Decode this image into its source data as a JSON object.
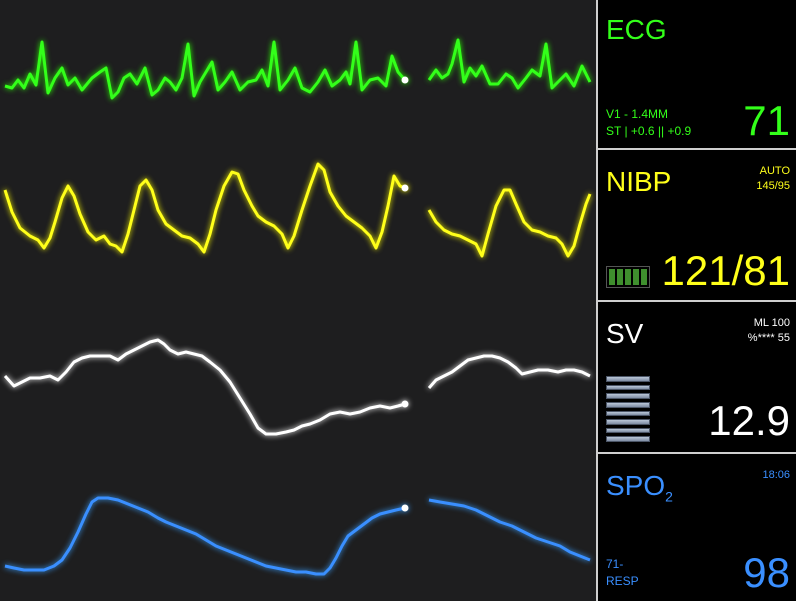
{
  "colors": {
    "ecg": "#33ff1a",
    "nibp": "#ffff1a",
    "sv": "#ffffff",
    "spo2": "#3a8fff"
  },
  "ecg": {
    "title": "ECG",
    "line1": "V1 - 1.4MM",
    "line2": "ST | +0.6 || +0.9",
    "value": "71"
  },
  "nibp": {
    "title": "NIBP",
    "mode": "AUTO",
    "last": "145/95",
    "value": "121/81",
    "battery_icon": "battery-icon"
  },
  "sv": {
    "title": "SV",
    "line1": "ML 100",
    "line2": "%**** 55",
    "value": "12.9",
    "bars_icon": "level-bars-icon"
  },
  "spo2": {
    "title": "SPO",
    "sub": "2",
    "time": "18:06",
    "line1": "71-",
    "line2": "RESP",
    "value": "98"
  }
}
